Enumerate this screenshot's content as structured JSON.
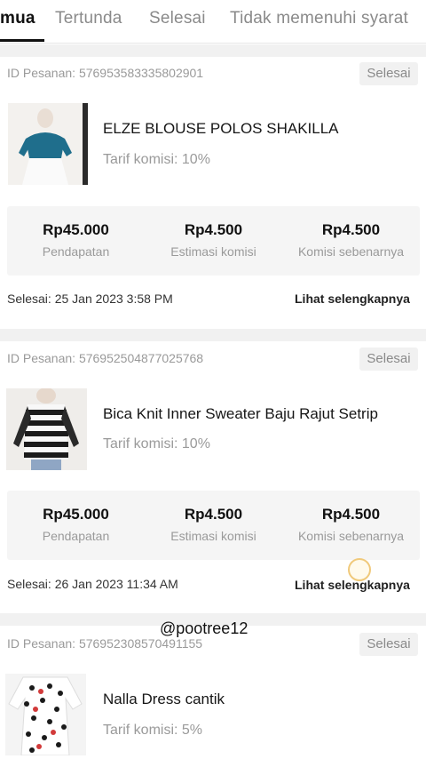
{
  "tabs": [
    "mua",
    "Tertunda",
    "Selesai",
    "Tidak memenuhi syarat"
  ],
  "active_tab": 0,
  "orders": [
    {
      "id_label": "ID Pesanan: 576953583335802901",
      "status": "Selesai",
      "product": "ELZE BLOUSE POLOS SHAKILLA",
      "rate": "Tarif komisi: 10%",
      "income": "Rp45.000",
      "income_label": "Pendapatan",
      "est": "Rp4.500",
      "est_label": "Estimasi komisi",
      "actual": "Rp4.500",
      "actual_label": "Komisi sebenarnya",
      "done": "Selesai: 25 Jan 2023 3:58 PM",
      "more": "Lihat selengkapnya"
    },
    {
      "id_label": "ID Pesanan: 576952504877025768",
      "status": "Selesai",
      "product": "Bica Knit Inner Sweater Baju Rajut Setrip",
      "rate": "Tarif komisi: 10%",
      "income": "Rp45.000",
      "income_label": "Pendapatan",
      "est": "Rp4.500",
      "est_label": "Estimasi komisi",
      "actual": "Rp4.500",
      "actual_label": "Komisi sebenarnya",
      "done": "Selesai: 26 Jan 2023 11:34 AM",
      "more": "Lihat selengkapnya"
    },
    {
      "id_label": "ID Pesanan: 576952308570491155",
      "status": "Selesai",
      "product": "Nalla Dress cantik",
      "rate": "Tarif komisi: 5%"
    }
  ],
  "watermark": "@pootree12",
  "colors": {
    "active_tab": "#111111",
    "muted": "#9a9a9a",
    "panel": "#f5f5f5",
    "badge_bg": "#f1f1f1"
  }
}
